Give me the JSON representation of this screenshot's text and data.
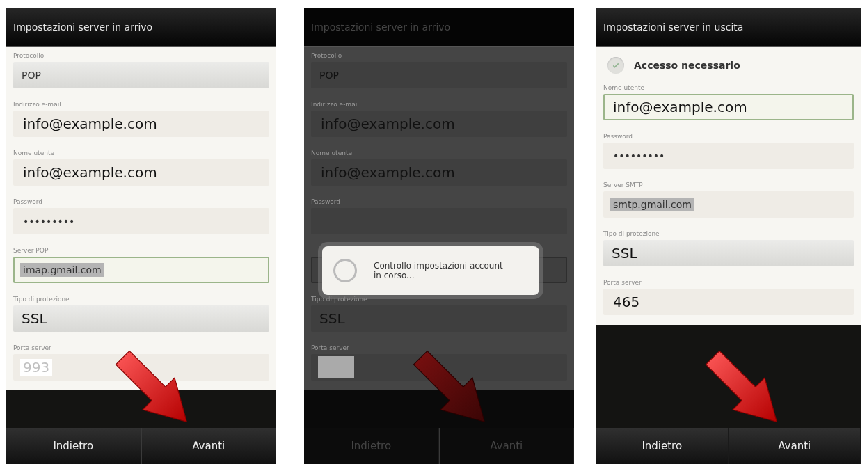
{
  "screens": [
    {
      "title": "Impostazioni server in arrivo",
      "dimmed": false,
      "fields": [
        {
          "kind": "spinner",
          "label": "Protocollo",
          "value": "POP",
          "focused": false,
          "highlighted": false
        },
        {
          "kind": "text",
          "label": "Indirizzo e-mail",
          "value": "info@example.com",
          "large": true,
          "focused": false,
          "highlighted": false
        },
        {
          "kind": "text",
          "label": "Nome utente",
          "value": "info@example.com",
          "large": true,
          "focused": false,
          "highlighted": false
        },
        {
          "kind": "text",
          "label": "Password",
          "value": "•••••••••",
          "focused": false,
          "highlighted": false
        },
        {
          "kind": "text",
          "label": "Server POP",
          "value": "imap.gmail.com",
          "focused": true,
          "highlighted": true
        },
        {
          "kind": "spinner",
          "label": "Tipo di protezione",
          "value": "SSL",
          "large": true,
          "focused": false,
          "highlighted": false
        },
        {
          "kind": "text",
          "label": "Porta server",
          "placeholder": "993",
          "focused": false,
          "highlighted": false
        }
      ],
      "buttons": [
        "Indietro",
        "Avanti"
      ]
    },
    {
      "title": "Impostazioni server in arrivo",
      "dimmed": true,
      "fields": [
        {
          "kind": "spinner",
          "label": "Protocollo",
          "value": "POP",
          "focused": false,
          "highlighted": false
        },
        {
          "kind": "text",
          "label": "Indirizzo e-mail",
          "value": "info@example.com",
          "large": true,
          "focused": false,
          "highlighted": false
        },
        {
          "kind": "text",
          "label": "Nome utente",
          "value": "info@example.com",
          "large": true,
          "focused": false,
          "highlighted": false
        },
        {
          "kind": "text",
          "label": "Password",
          "focused": false
        },
        {
          "kind": "text",
          "focused": true
        },
        {
          "kind": "spinner",
          "label": "Tipo di protezione",
          "value": "SSL",
          "large": true,
          "focused": false,
          "highlighted": false
        },
        {
          "kind": "text",
          "label": "Porta server",
          "focused": false,
          "highlighted": true
        }
      ],
      "dialog": {
        "message": "Controllo impostazioni account in corso..."
      },
      "buttons": [
        "Indietro",
        "Avanti"
      ]
    },
    {
      "title": "Impostazioni server in uscita",
      "dimmed": false,
      "fields": [
        {
          "kind": "checkbox",
          "label": "Accesso necessario",
          "checked": true
        },
        {
          "kind": "text",
          "label": "Nome utente",
          "value": "info@example.com",
          "large": true,
          "focused": true,
          "highlighted": false
        },
        {
          "kind": "text",
          "label": "Password",
          "value": "•••••••••",
          "focused": false,
          "highlighted": false
        },
        {
          "kind": "text",
          "label": "Server SMTP",
          "value": "smtp.gmail.com",
          "focused": false,
          "highlighted": true
        },
        {
          "kind": "spinner",
          "label": "Tipo di protezione",
          "value": "SSL",
          "large": true,
          "focused": false,
          "highlighted": false
        },
        {
          "kind": "text",
          "label": "Porta server",
          "value": "465",
          "large": true,
          "focused": false,
          "highlighted": false
        }
      ],
      "buttons": [
        "Indietro",
        "Avanti"
      ]
    }
  ]
}
